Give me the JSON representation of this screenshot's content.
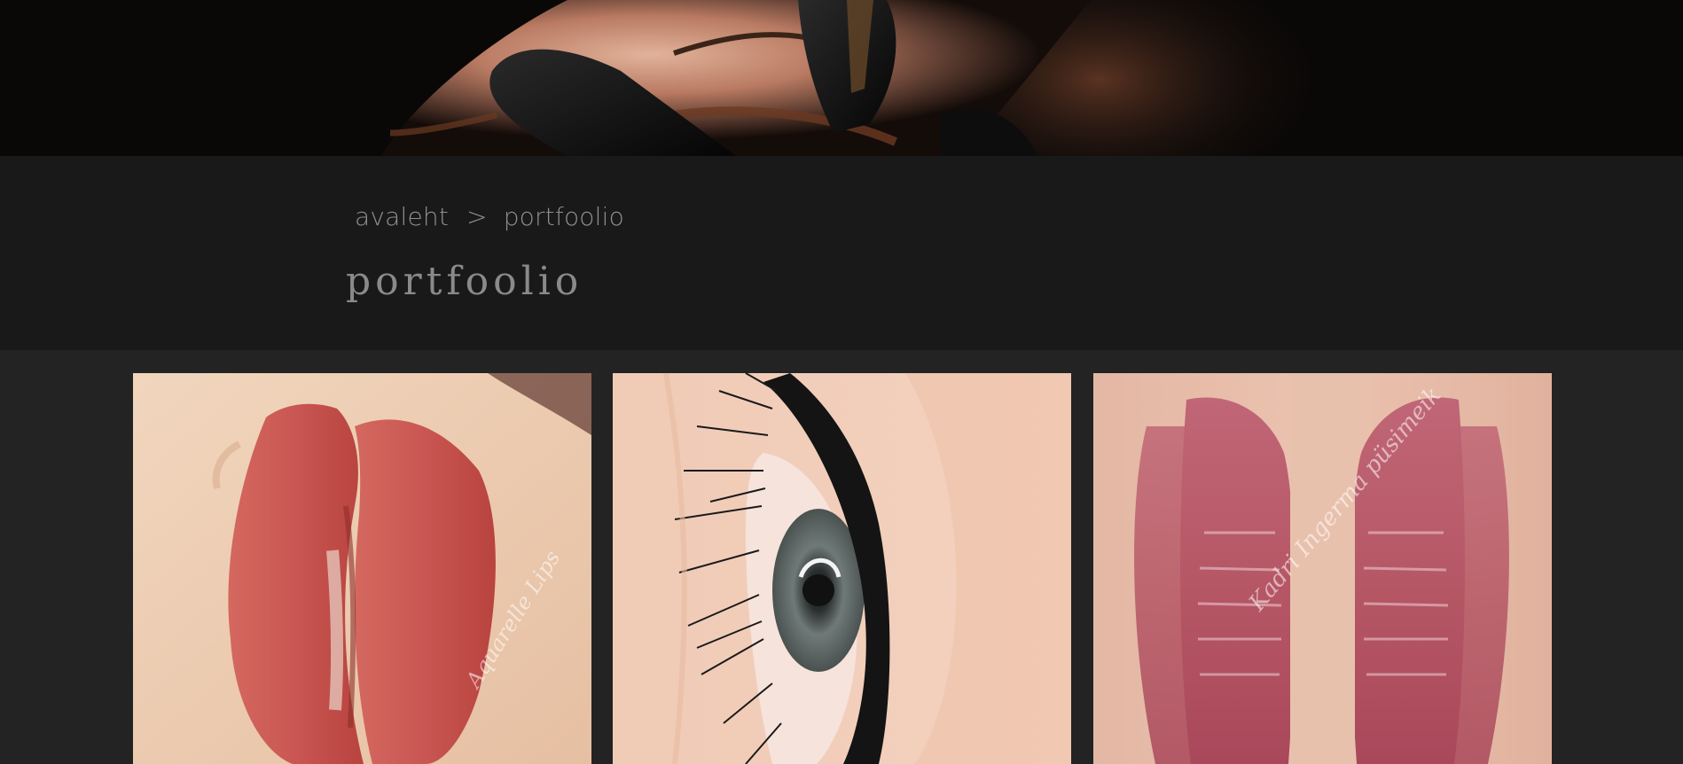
{
  "hero": {
    "image_name": "permanent-makeup-brow-procedure-photo"
  },
  "breadcrumb": {
    "home_label": "avaleht",
    "separator": ">",
    "current_label": "portfoolio"
  },
  "page": {
    "title": "portfoolio"
  },
  "gallery": {
    "items": [
      {
        "image_name": "aquarelle-lips-photo",
        "watermark": "Aquarelle Lips"
      },
      {
        "image_name": "eyeliner-tattoo-photo",
        "watermark": ""
      },
      {
        "image_name": "lip-blush-photo",
        "watermark": "Kadri Ingerma püsimeik"
      }
    ]
  },
  "colors": {
    "hero_background": "#0a0807",
    "title_band": "#191919",
    "page_background": "#232323",
    "breadcrumb_text": "#8f8f8f",
    "title_text": "#8a8a8a"
  }
}
